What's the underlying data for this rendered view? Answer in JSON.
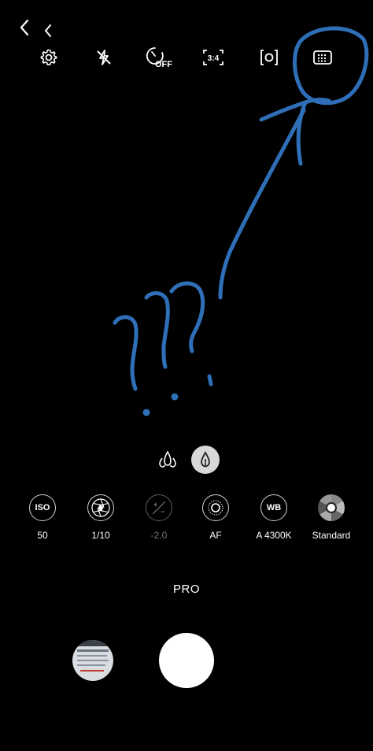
{
  "nav": {
    "back_icon_1": "chevron-left-icon",
    "back_icon_2": "chevron-left-icon"
  },
  "top_bar": {
    "settings_icon": "gear-icon",
    "flash_icon": "flash-off-icon",
    "timer_icon": "timer-icon",
    "timer_label": "OFF",
    "ratio_label": "3:4",
    "motion_icon": "motion-photo-icon",
    "grid_icon": "grid-icon"
  },
  "metering": {
    "left_icon": "drops-multi-icon",
    "right_icon": "drops-single-icon"
  },
  "pro_settings": [
    {
      "badge": "ISO",
      "value": "50"
    },
    {
      "badge": "",
      "value": "1/10"
    },
    {
      "badge": "",
      "value": "-2.0"
    },
    {
      "badge": "",
      "value": "AF"
    },
    {
      "badge": "WB",
      "value": "A 4300K"
    },
    {
      "badge": "",
      "value": "Standard"
    }
  ],
  "mode": {
    "label": "PRO"
  },
  "colors": {
    "drawing": "#2f6fb8",
    "background": "#000000"
  }
}
